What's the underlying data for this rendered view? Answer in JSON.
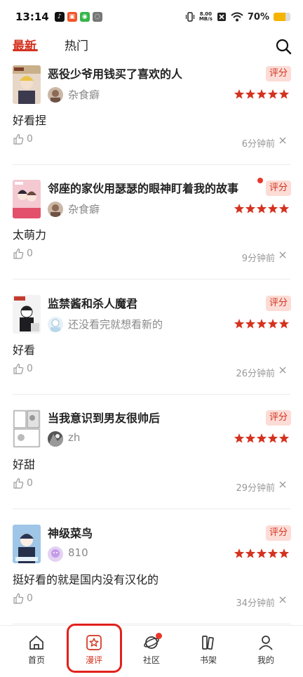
{
  "status_bar": {
    "time": "13:14",
    "app_icons": [
      "tiktok-icon",
      "app-icon",
      "app-icon",
      "wechat-icon"
    ],
    "net_speed_value": "8.00",
    "net_speed_unit": "MB/s",
    "battery_percent": "70%",
    "battery_level": 0.7
  },
  "tabs": [
    {
      "label": "最新",
      "active": true
    },
    {
      "label": "热门",
      "active": false
    }
  ],
  "accent_color": "#d4321f",
  "rate_label": "评分",
  "reviews": [
    {
      "title": "恶役少爷用钱买了喜欢的人",
      "user": "杂食癖",
      "rating": 5,
      "comment": "好看捏",
      "likes": "0",
      "time": "6分钟前",
      "has_dot": false
    },
    {
      "title": "邻座的家伙用瑟瑟的眼神盯着我的故事",
      "user": "杂食癖",
      "rating": 5,
      "comment": "太萌力",
      "likes": "0",
      "time": "9分钟前",
      "has_dot": true
    },
    {
      "title": "监禁酱和杀人魔君",
      "user": "还没看完就想看新的",
      "rating": 5,
      "comment": "好看",
      "likes": "0",
      "time": "26分钟前",
      "has_dot": false
    },
    {
      "title": "当我意识到男友很帅后",
      "user": "zh",
      "rating": 5,
      "comment": "好甜",
      "likes": "0",
      "time": "29分钟前",
      "has_dot": false
    },
    {
      "title": "神级菜鸟",
      "user": "810",
      "rating": 5,
      "comment": "挺好看的就是国内没有汉化的",
      "likes": "0",
      "time": "34分钟前",
      "has_dot": false
    }
  ],
  "bottom_nav": [
    {
      "label": "首页",
      "icon": "home-icon",
      "active": false
    },
    {
      "label": "漫评",
      "icon": "star-icon",
      "active": true
    },
    {
      "label": "社区",
      "icon": "planet-icon",
      "active": false,
      "badge": true
    },
    {
      "label": "书架",
      "icon": "bookshelf-icon",
      "active": false
    },
    {
      "label": "我的",
      "icon": "person-icon",
      "active": false
    }
  ]
}
